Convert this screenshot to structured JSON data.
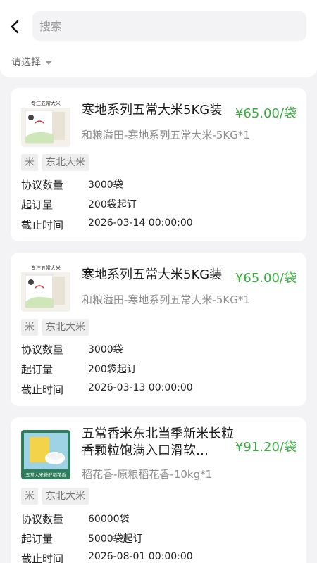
{
  "header": {
    "back_icon": "chevron-left-icon",
    "search_placeholder": "搜索"
  },
  "filter": {
    "label": "请选择",
    "caret_icon": "caret-down-icon"
  },
  "field_labels": {
    "quantity": "协议数量",
    "min_order": "起订量",
    "deadline": "截止时间"
  },
  "products": [
    {
      "title": "寒地系列五常大米5KG装",
      "price": "¥65.00/袋",
      "subtitle": "和粮溢田-寒地系列五常大米-5KG*1",
      "tags": [
        "米",
        "东北大米"
      ],
      "quantity": "3000袋",
      "min_order": "200袋起订",
      "deadline": "2026-03-14 00:00:00",
      "image_text": "专注五常大米"
    },
    {
      "title": "寒地系列五常大米5KG装",
      "price": "¥65.00/袋",
      "subtitle": "和粮溢田-寒地系列五常大米-5KG*1",
      "tags": [
        "米",
        "东北大米"
      ],
      "quantity": "3000袋",
      "min_order": "200袋起订",
      "deadline": "2026-03-13 00:00:00",
      "image_text": "专注五常大米"
    },
    {
      "title": "五常香米东北当季新米长粒香颗粒饱满入口滑软…",
      "price": "¥91.20/袋",
      "subtitle": "稻花香-原粮稻花香-10kg*1",
      "tags": [
        "米",
        "东北大米"
      ],
      "quantity": "60000袋",
      "min_order": "5000袋起订",
      "deadline": "2026-08-01 00:00:00",
      "image_text": "五常大米新鲜稻花香"
    }
  ],
  "colors": {
    "price_green": "#3dab43",
    "page_bg": "#f3f3f5"
  }
}
